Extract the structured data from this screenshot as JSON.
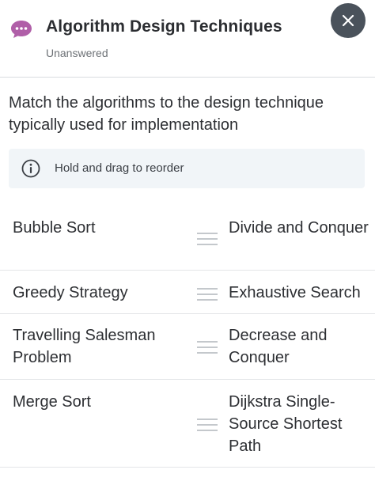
{
  "header": {
    "title": "Algorithm Design Techniques",
    "status": "Unanswered",
    "icon": "chat-bubble-icon",
    "icon_color": "#b05fa8",
    "close_icon": "close-icon"
  },
  "question": {
    "text": "Match the algorithms to the design technique typically used for implementation"
  },
  "hint": {
    "icon": "info-icon",
    "text": "Hold and drag to reorder"
  },
  "matches": [
    {
      "left": "Bubble Sort",
      "right": "Divide and Conquer"
    },
    {
      "left": "Greedy Strategy",
      "right": "Exhaustive Search"
    },
    {
      "left": "Travelling Salesman Problem",
      "right": "Decrease and Conquer"
    },
    {
      "left": "Merge Sort",
      "right": "Dijkstra Single-Source Shortest Path"
    }
  ],
  "colors": {
    "close_button": "#4a525b",
    "hint_background": "#f1f5f8",
    "divider": "#e3e5e8"
  }
}
